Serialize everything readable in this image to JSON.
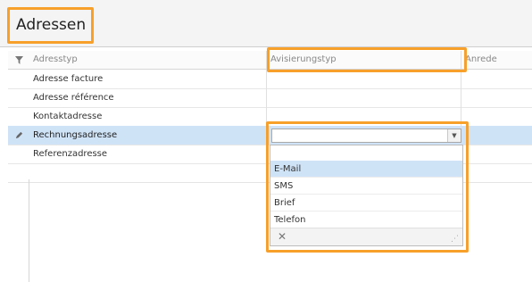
{
  "panel": {
    "title": "Adressen"
  },
  "grid": {
    "columns": [
      "Adresstyp",
      "Avisierungstyp",
      "Anrede"
    ],
    "rows": [
      {
        "adresstyp": "Adresse facture",
        "avisierungstyp": ""
      },
      {
        "adresstyp": "Adresse référence",
        "avisierungstyp": ""
      },
      {
        "adresstyp": "Kontaktadresse",
        "avisierungstyp": ""
      },
      {
        "adresstyp": "Rechnungsadresse",
        "avisierungstyp": "",
        "selected": true
      },
      {
        "adresstyp": "Referenzadresse",
        "avisierungstyp": ""
      }
    ]
  },
  "dropdown": {
    "value": "",
    "options": [
      "E-Mail",
      "SMS",
      "Brief",
      "Telefon"
    ],
    "highlighted": "E-Mail"
  },
  "icons": {
    "filter": "filter-icon",
    "edit": "pencil-icon",
    "dropdown_arrow": "chevron-down-icon",
    "clear": "close-icon",
    "resize": "resize-grip-icon"
  },
  "colors": {
    "highlight_border": "#f7a02a",
    "selected_row": "#cfe3f7"
  }
}
